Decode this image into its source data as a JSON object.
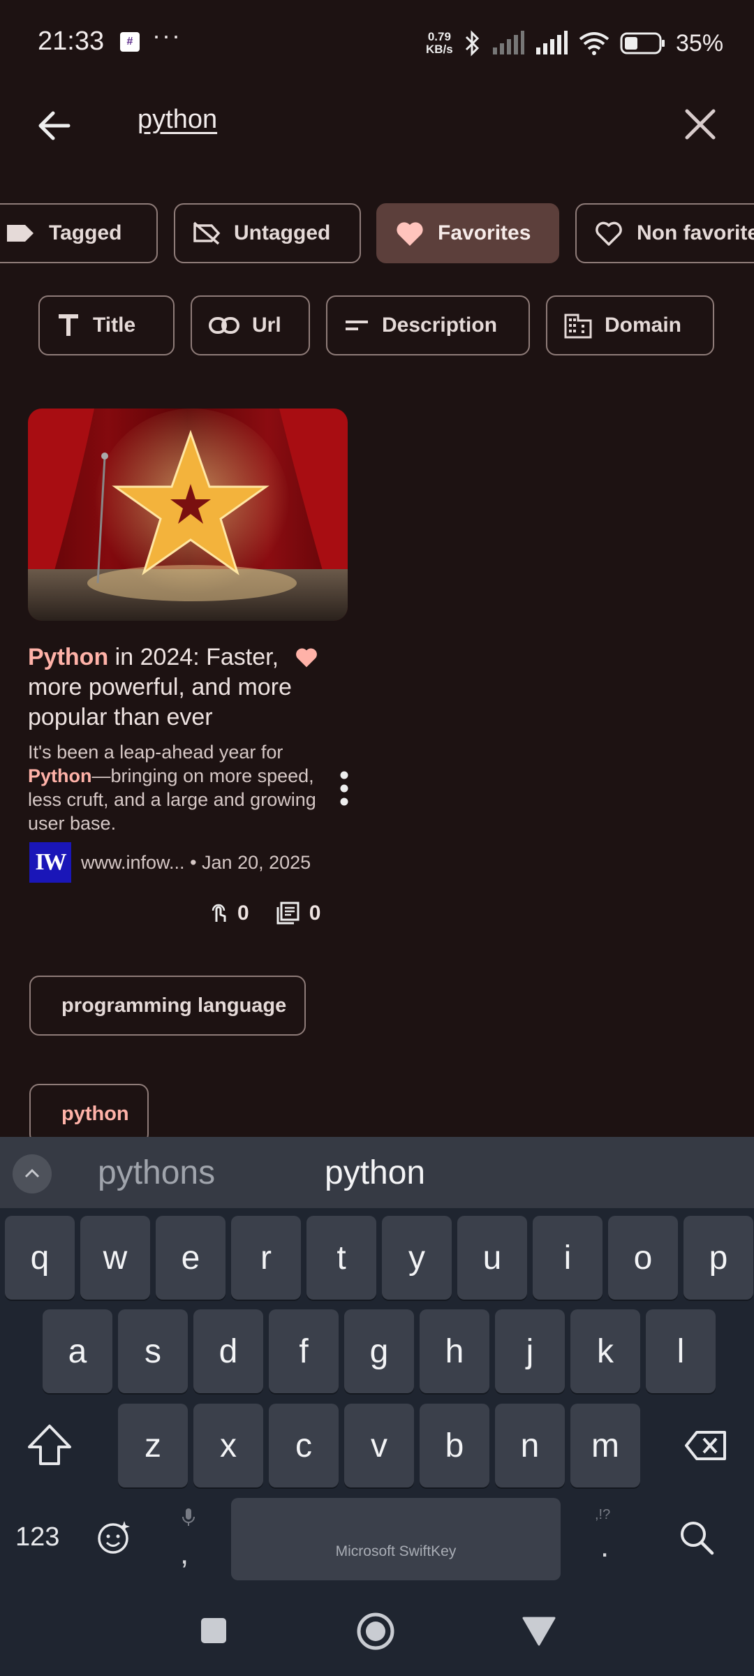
{
  "status_bar": {
    "time": "21:33",
    "dots": "···",
    "net_speed_value": "0.79",
    "net_speed_unit": "KB/s",
    "battery": "35%"
  },
  "search": {
    "query": "python"
  },
  "filter_chips": [
    {
      "label": "Tagged",
      "icon": "label-icon",
      "selected": false
    },
    {
      "label": "Untagged",
      "icon": "label-off-icon",
      "selected": false
    },
    {
      "label": "Favorites",
      "icon": "heart-filled-icon",
      "selected": true
    },
    {
      "label": "Non favorite",
      "icon": "heart-outline-icon",
      "selected": false
    }
  ],
  "field_chips": [
    {
      "label": "Title",
      "icon": "text-icon"
    },
    {
      "label": "Url",
      "icon": "link-icon"
    },
    {
      "label": "Description",
      "icon": "description-icon"
    },
    {
      "label": "Domain",
      "icon": "domain-icon"
    }
  ],
  "card": {
    "title_highlight": "Python",
    "title_rest": " in 2024: Faster, more powerful, and more popular than ever",
    "desc_pre": "It's been a leap-ahead year for ",
    "desc_highlight": "Python",
    "desc_post": "—bringing on more speed, less cruft, and a large and growing user base.",
    "favicon_text": "IW",
    "domain": "www.infow...",
    "date": "• Jan 20, 2025",
    "clicks": "0",
    "notes": "0",
    "tags": [
      "programming language",
      "python"
    ]
  },
  "keyboard": {
    "suggestions": [
      "pythons",
      "python"
    ],
    "row1": [
      "q",
      "w",
      "e",
      "r",
      "t",
      "y",
      "u",
      "i",
      "o",
      "p"
    ],
    "row2": [
      "a",
      "s",
      "d",
      "f",
      "g",
      "h",
      "j",
      "k",
      "l"
    ],
    "row3": [
      "z",
      "x",
      "c",
      "v",
      "b",
      "n",
      "m"
    ],
    "numbers_label": "123",
    "comma": ",",
    "period": ".",
    "comma_hint": "🎤",
    "period_hint": ",!?",
    "space_label": "Microsoft SwiftKey"
  },
  "colors": {
    "background": "#1d1212",
    "accent": "#ffb2a8",
    "selected_chip": "#5c3f3b",
    "keyboard": "#1f2530"
  }
}
